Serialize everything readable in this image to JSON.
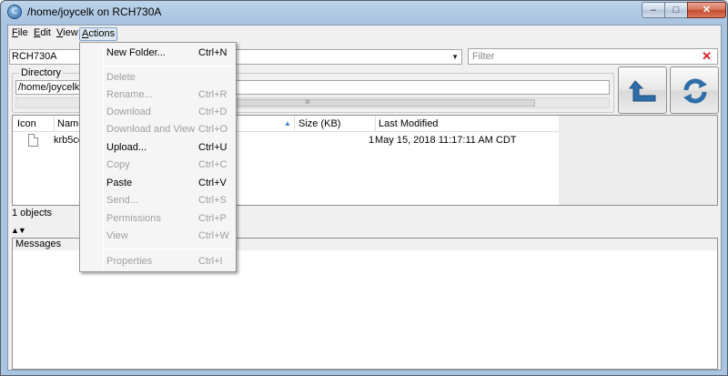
{
  "window": {
    "title": "/home/joycelk on RCH730A",
    "buttons": {
      "minimize": "–",
      "maximize": "□",
      "close": "✕"
    }
  },
  "menubar": {
    "items": [
      {
        "label": "File",
        "underline": "F",
        "rest": "ile"
      },
      {
        "label": "Edit",
        "underline": "E",
        "rest": "dit"
      },
      {
        "label": "View",
        "underline": "V",
        "rest": "iew"
      },
      {
        "label": "Actions",
        "underline": "A",
        "rest": "ctions"
      }
    ]
  },
  "site": {
    "value": "RCH730A"
  },
  "filter": {
    "placeholder": "Filter",
    "clear_icon": "close-x-icon"
  },
  "directory": {
    "legend": "Directory",
    "path": "/home/joycelk",
    "scroll_grip": "III"
  },
  "toolbar": {
    "up_icon": "up-arrow-icon",
    "refresh_icon": "refresh-icon"
  },
  "table": {
    "columns": [
      "Icon",
      "Name",
      "Size (KB)",
      "Last Modified"
    ],
    "rows": [
      {
        "name": "krb5cc",
        "size": "1",
        "modified": "May 15, 2018 11:17:11 AM CDT"
      }
    ]
  },
  "status": {
    "objects": "1 objects"
  },
  "splitter": {
    "glyph": "▲▼"
  },
  "messages": {
    "header": "Messages"
  },
  "actions_menu": {
    "items": [
      {
        "label": "New Folder...",
        "shortcut": "Ctrl+N",
        "enabled": true
      },
      {
        "label": "Delete",
        "shortcut": "",
        "enabled": false
      },
      {
        "label": "Rename...",
        "shortcut": "Ctrl+R",
        "enabled": false
      },
      {
        "label": "Download",
        "shortcut": "Ctrl+D",
        "enabled": false
      },
      {
        "label": "Download and View",
        "shortcut": "Ctrl+O",
        "enabled": false
      },
      {
        "label": "Upload...",
        "shortcut": "Ctrl+U",
        "enabled": true
      },
      {
        "label": "Copy",
        "shortcut": "Ctrl+C",
        "enabled": false
      },
      {
        "label": "Paste",
        "shortcut": "Ctrl+V",
        "enabled": true
      },
      {
        "label": "Send...",
        "shortcut": "Ctrl+S",
        "enabled": false
      },
      {
        "label": "Permissions",
        "shortcut": "Ctrl+P",
        "enabled": false
      },
      {
        "label": "View",
        "shortcut": "Ctrl+W",
        "enabled": false
      },
      {
        "label": "Properties",
        "shortcut": "Ctrl+I",
        "enabled": false
      }
    ]
  },
  "colors": {
    "accent": "#2d6da8",
    "disabled_text": "#a0a0a0",
    "clear_red": "#d21f1f"
  }
}
